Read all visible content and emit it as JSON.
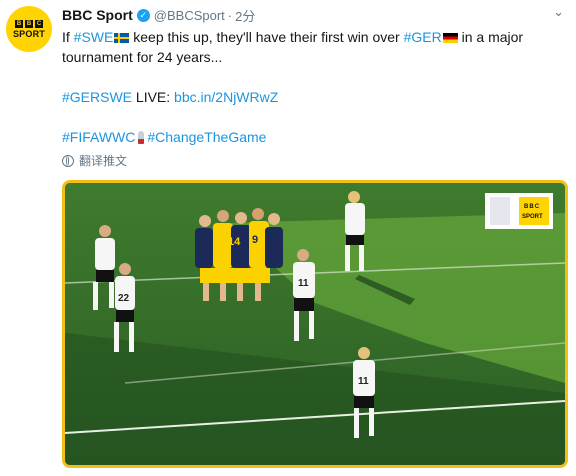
{
  "tweet": {
    "account_name": "BBC Sport",
    "handle": "@BBCSport",
    "separator": "·",
    "time": "2分",
    "avatar": {
      "top_text": [
        "B",
        "B",
        "C"
      ],
      "bottom_text": "SPORT",
      "color": "#ffd400"
    },
    "text": {
      "line1_pre": "If ",
      "hashtag_swe": "#SWE",
      "line1_mid": " keep this up, they'll have their first win over ",
      "hashtag_ger": "#GER",
      "line1_post": " in a major tournament for 24 years...",
      "hashtag_match": "#GERSWE",
      "live_label": " LIVE: ",
      "live_link": "bbc.in/2NjWRwZ",
      "hashtag_fifa": "#FIFAWWC",
      "hashtag_change": "#ChangeTheGame"
    },
    "translate_label": "翻译推文",
    "media": {
      "overlay_logo": {
        "bbc": [
          "B",
          "B",
          "C"
        ],
        "sport": "SPORT"
      },
      "border_color": "#f1bf15",
      "shirt_numbers": [
        "14",
        "9",
        "22",
        "11",
        "11"
      ]
    }
  },
  "colors": {
    "link": "#1b95e0",
    "muted": "#657786",
    "verified": "#1da1f2"
  }
}
